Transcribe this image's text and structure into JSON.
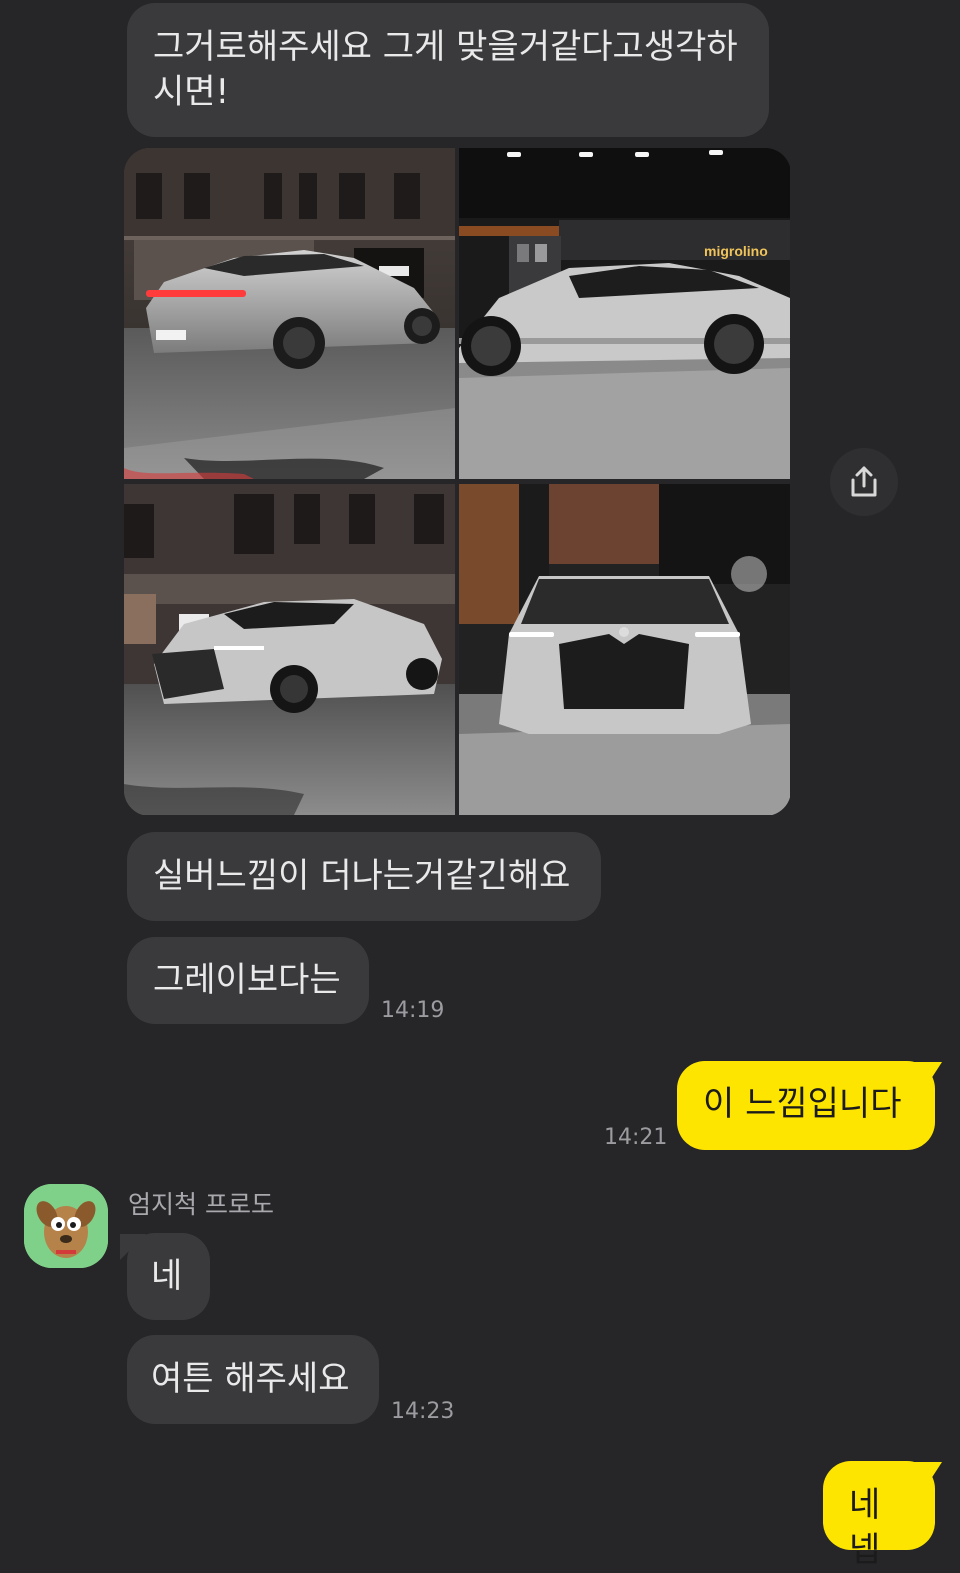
{
  "messages": {
    "m1": "그거로해주세요 그게 맞을거같다고생각하\n시면!",
    "m2": "실버느낌이 더나는거같긴해요",
    "m3": "그레이보다는",
    "m3_time": "14:19",
    "m4": "이 느낌입니다",
    "m4_time": "14:21",
    "sender": "엄지척 프로도",
    "m5": "네",
    "m6": "여튼 해주세요",
    "m6_time": "14:23",
    "m7": "네넵"
  },
  "photo_sign": "migrolino",
  "photo_plate": "",
  "icons": {
    "share": "share-upload-icon",
    "avatar": "frodo-dog-avatar-icon"
  },
  "colors": {
    "background": "#262629",
    "incoming_bubble": "#3a3a3d",
    "outgoing_bubble": "#fee500",
    "timestamp": "#9c9ca0"
  }
}
